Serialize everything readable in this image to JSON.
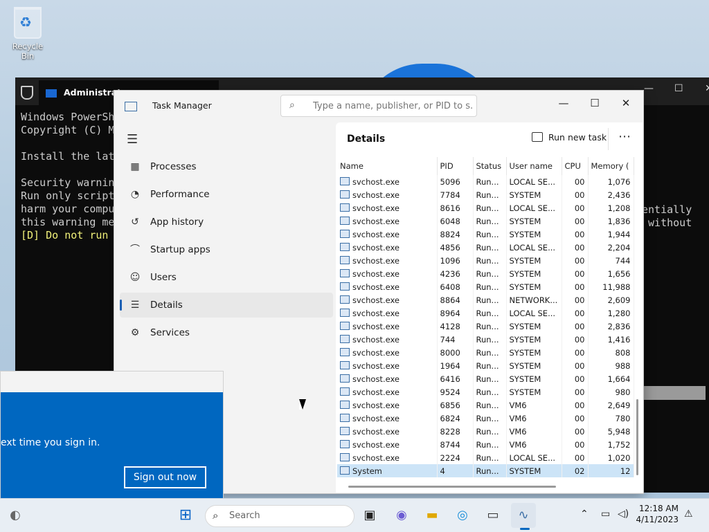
{
  "desktop": {
    "recycle_label": "Recycle Bin"
  },
  "powershell": {
    "tab_title": "Administrato",
    "lines": "Windows PowerSh\nCopyright (C) M\n\nInstall the lat\n\nSecurity warnin\nRun only script\nharm your compu\nthis warning me",
    "prompt_line": "[D] Do not run",
    "right_lines": "entially\n without"
  },
  "taskmanager": {
    "title": "Task Manager",
    "search_placeholder": "Type a name, publisher, or PID to s...",
    "nav": [
      {
        "label": "Processes"
      },
      {
        "label": "Performance"
      },
      {
        "label": "App history"
      },
      {
        "label": "Startup apps"
      },
      {
        "label": "Users"
      },
      {
        "label": "Details"
      },
      {
        "label": "Services"
      }
    ],
    "details_title": "Details",
    "run_new_task": "Run new task",
    "columns": [
      "Name",
      "PID",
      "Status",
      "User name",
      "CPU",
      "Memory ("
    ],
    "rows": [
      {
        "name": "svchost.exe",
        "pid": "5096",
        "status": "Run...",
        "user": "LOCAL SE...",
        "cpu": "00",
        "mem": "1,076"
      },
      {
        "name": "svchost.exe",
        "pid": "7784",
        "status": "Run...",
        "user": "SYSTEM",
        "cpu": "00",
        "mem": "2,436"
      },
      {
        "name": "svchost.exe",
        "pid": "8616",
        "status": "Run...",
        "user": "LOCAL SE...",
        "cpu": "00",
        "mem": "1,208"
      },
      {
        "name": "svchost.exe",
        "pid": "6048",
        "status": "Run...",
        "user": "SYSTEM",
        "cpu": "00",
        "mem": "1,836"
      },
      {
        "name": "svchost.exe",
        "pid": "8824",
        "status": "Run...",
        "user": "SYSTEM",
        "cpu": "00",
        "mem": "1,944"
      },
      {
        "name": "svchost.exe",
        "pid": "4856",
        "status": "Run...",
        "user": "LOCAL SE...",
        "cpu": "00",
        "mem": "2,204"
      },
      {
        "name": "svchost.exe",
        "pid": "1096",
        "status": "Run...",
        "user": "SYSTEM",
        "cpu": "00",
        "mem": "744"
      },
      {
        "name": "svchost.exe",
        "pid": "4236",
        "status": "Run...",
        "user": "SYSTEM",
        "cpu": "00",
        "mem": "1,656"
      },
      {
        "name": "svchost.exe",
        "pid": "6408",
        "status": "Run...",
        "user": "SYSTEM",
        "cpu": "00",
        "mem": "11,988"
      },
      {
        "name": "svchost.exe",
        "pid": "8864",
        "status": "Run...",
        "user": "NETWORK...",
        "cpu": "00",
        "mem": "2,609"
      },
      {
        "name": "svchost.exe",
        "pid": "8964",
        "status": "Run...",
        "user": "LOCAL SE...",
        "cpu": "00",
        "mem": "1,280"
      },
      {
        "name": "svchost.exe",
        "pid": "4128",
        "status": "Run...",
        "user": "SYSTEM",
        "cpu": "00",
        "mem": "2,836"
      },
      {
        "name": "svchost.exe",
        "pid": "744",
        "status": "Run...",
        "user": "SYSTEM",
        "cpu": "00",
        "mem": "1,416"
      },
      {
        "name": "svchost.exe",
        "pid": "8000",
        "status": "Run...",
        "user": "SYSTEM",
        "cpu": "00",
        "mem": "808"
      },
      {
        "name": "svchost.exe",
        "pid": "1964",
        "status": "Run...",
        "user": "SYSTEM",
        "cpu": "00",
        "mem": "988"
      },
      {
        "name": "svchost.exe",
        "pid": "6416",
        "status": "Run...",
        "user": "SYSTEM",
        "cpu": "00",
        "mem": "1,664"
      },
      {
        "name": "svchost.exe",
        "pid": "9524",
        "status": "Run...",
        "user": "SYSTEM",
        "cpu": "00",
        "mem": "980"
      },
      {
        "name": "svchost.exe",
        "pid": "6856",
        "status": "Run...",
        "user": "VM6",
        "cpu": "00",
        "mem": "2,649"
      },
      {
        "name": "svchost.exe",
        "pid": "6824",
        "status": "Run...",
        "user": "VM6",
        "cpu": "00",
        "mem": "780"
      },
      {
        "name": "svchost.exe",
        "pid": "8228",
        "status": "Run...",
        "user": "VM6",
        "cpu": "00",
        "mem": "5,948"
      },
      {
        "name": "svchost.exe",
        "pid": "8744",
        "status": "Run...",
        "user": "VM6",
        "cpu": "00",
        "mem": "1,752"
      },
      {
        "name": "svchost.exe",
        "pid": "2224",
        "status": "Run...",
        "user": "LOCAL SE...",
        "cpu": "00",
        "mem": "1,020"
      },
      {
        "name": "System",
        "pid": "4",
        "status": "Run...",
        "user": "SYSTEM",
        "cpu": "02",
        "mem": "12"
      }
    ]
  },
  "notification": {
    "message": "ext time you sign in.",
    "button": "Sign out now"
  },
  "taskbar": {
    "search_label": "Search",
    "time": "12:18 AM",
    "date": "4/11/2023"
  },
  "colors": {
    "accent": "#0067c0",
    "terminal_bg": "#0c0c0c",
    "selected_row": "#cce4f7"
  }
}
